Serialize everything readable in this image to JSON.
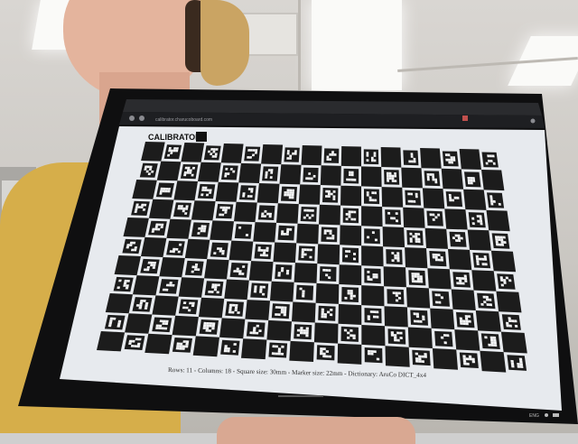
{
  "browser": {
    "url": "calibrator.charucoboard.com",
    "status_lang": "ENG"
  },
  "page": {
    "logo_text": "CALIBRATOR",
    "caption": "Rows: 11 - Columns: 18 - Square size: 30mm - Marker size: 22mm - Dictionary: AruCo DICT_4x4"
  },
  "board": {
    "rows": 11,
    "columns": 18,
    "dictionary": "DICT_4x4"
  },
  "colors": {
    "board_dark": "#1c1c1c",
    "screen_bg": "#e9ecf0",
    "shirt": "#d8b24a",
    "cap": "#c9a463"
  }
}
